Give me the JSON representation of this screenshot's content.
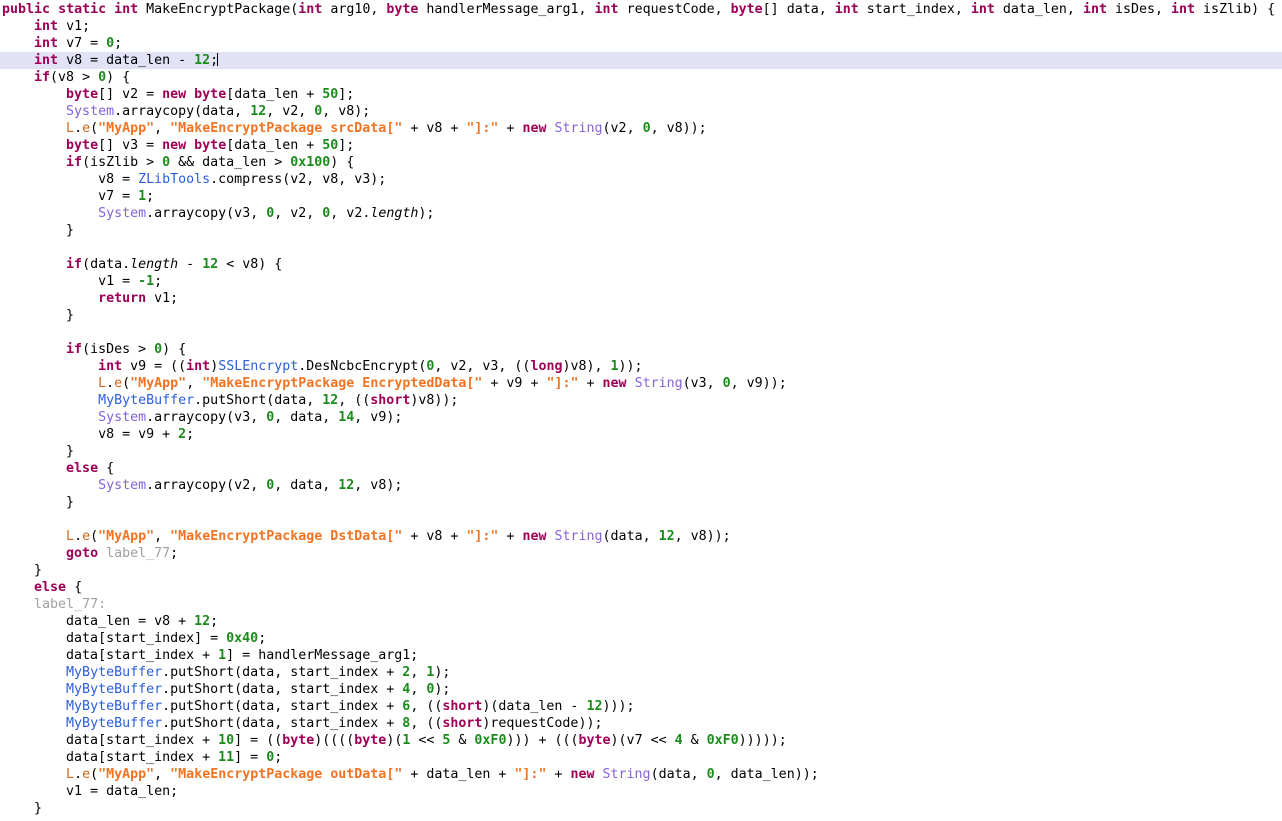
{
  "editor": {
    "language": "java-decompiled",
    "background_color": "#ffffff",
    "highlight_line_color": "#e2e2f6",
    "highlighted_line_number": 4,
    "caret_line": 4,
    "colors": {
      "keyword": "#9c0057",
      "number": "#1a8c1a",
      "string": "#f07423",
      "class": "#2b5fd9",
      "system_class": "#8262d8",
      "type": "#8a62d6",
      "logger": "#d2691e",
      "label": "#a0a0a0",
      "identifier": "#000000"
    },
    "method_name": "MakeEncryptPackage",
    "log_tag": "MyApp",
    "lines": [
      "public static int MakeEncryptPackage(int arg10, byte handlerMessage_arg1, int requestCode, byte[] data, int start_index, int data_len, int isDes, int isZlib) {",
      "    int v1;",
      "    int v7 = 0;",
      "    int v8 = data_len - 12;",
      "    if(v8 > 0) {",
      "        byte[] v2 = new byte[data_len + 50];",
      "        System.arraycopy(data, 12, v2, 0, v8);",
      "        L.e(\"MyApp\", \"MakeEncryptPackage srcData[\" + v8 + \"]:\" + new String(v2, 0, v8));",
      "        byte[] v3 = new byte[data_len + 50];",
      "        if(isZlib > 0 && data_len > 0x100) {",
      "            v8 = ZLibTools.compress(v2, v8, v3);",
      "            v7 = 1;",
      "            System.arraycopy(v3, 0, v2, 0, v2.length);",
      "        }",
      "",
      "        if(data.length - 12 < v8) {",
      "            v1 = -1;",
      "            return v1;",
      "        }",
      "",
      "        if(isDes > 0) {",
      "            int v9 = ((int)SSLEncrypt.DesNcbcEncrypt(0, v2, v3, ((long)v8), 1));",
      "            L.e(\"MyApp\", \"MakeEncryptPackage EncryptedData[\" + v9 + \"]:\" + new String(v3, 0, v9));",
      "            MyByteBuffer.putShort(data, 12, ((short)v8));",
      "            System.arraycopy(v3, 0, data, 14, v9);",
      "            v8 = v9 + 2;",
      "        }",
      "        else {",
      "            System.arraycopy(v2, 0, data, 12, v8);",
      "        }",
      "",
      "        L.e(\"MyApp\", \"MakeEncryptPackage DstData[\" + v8 + \"]:\" + new String(data, 12, v8));",
      "        goto label_77;",
      "    }",
      "    else {",
      "    label_77:",
      "        data_len = v8 + 12;",
      "        data[start_index] = 0x40;",
      "        data[start_index + 1] = handlerMessage_arg1;",
      "        MyByteBuffer.putShort(data, start_index + 2, 1);",
      "        MyByteBuffer.putShort(data, start_index + 4, 0);",
      "        MyByteBuffer.putShort(data, start_index + 6, ((short)(data_len - 12)));",
      "        MyByteBuffer.putShort(data, start_index + 8, ((short)requestCode));",
      "        data[start_index + 10] = ((byte)((((byte)(1 << 5 & 0xF0))) + (((byte)(v7 << 4 & 0xF0)))));",
      "        data[start_index + 11] = 0;",
      "        L.e(\"MyApp\", \"MakeEncryptPackage outData[\" + data_len + \"]:\" + new String(data, 0, data_len));",
      "        v1 = data_len;",
      "    }"
    ]
  }
}
